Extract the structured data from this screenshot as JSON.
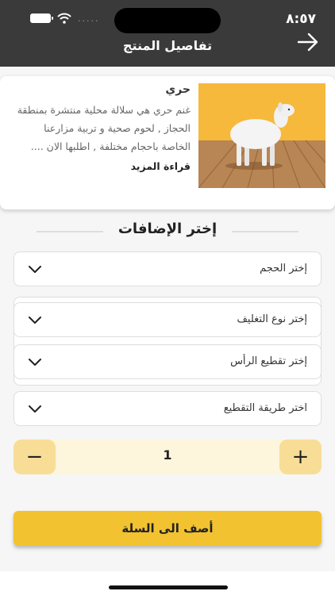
{
  "status_bar": {
    "time": "٨:٥٧",
    "signal_dots": "....."
  },
  "header": {
    "title": "تفاصيل المنتج"
  },
  "product": {
    "name": "حري",
    "description": "غنم حري هي سلالة محلية منتشرة بمنطقة الحجاز , لحوم صحية و تربية مزارعنا الخاصة باحجام مختلفة , اطلبها الان ....",
    "read_more": "قراءة المزيد"
  },
  "addons": {
    "title": "إختر الإضافات",
    "size_label": "إختر الحجم",
    "packaging_label": "إختر نوع التغليف",
    "head_cut_label": "إختر  تقطيع الرأس",
    "cutting_label": "اختر طريقة التقطيع"
  },
  "quantity": {
    "value": "1",
    "minus": "−",
    "plus": "+"
  },
  "cart": {
    "add_label": "أصف الى السلة"
  },
  "colors": {
    "header_bg": "#3a3a3a",
    "accent": "#f2c230",
    "qty_btn": "#f8dd96",
    "qty_bg": "#fdf5dc"
  }
}
